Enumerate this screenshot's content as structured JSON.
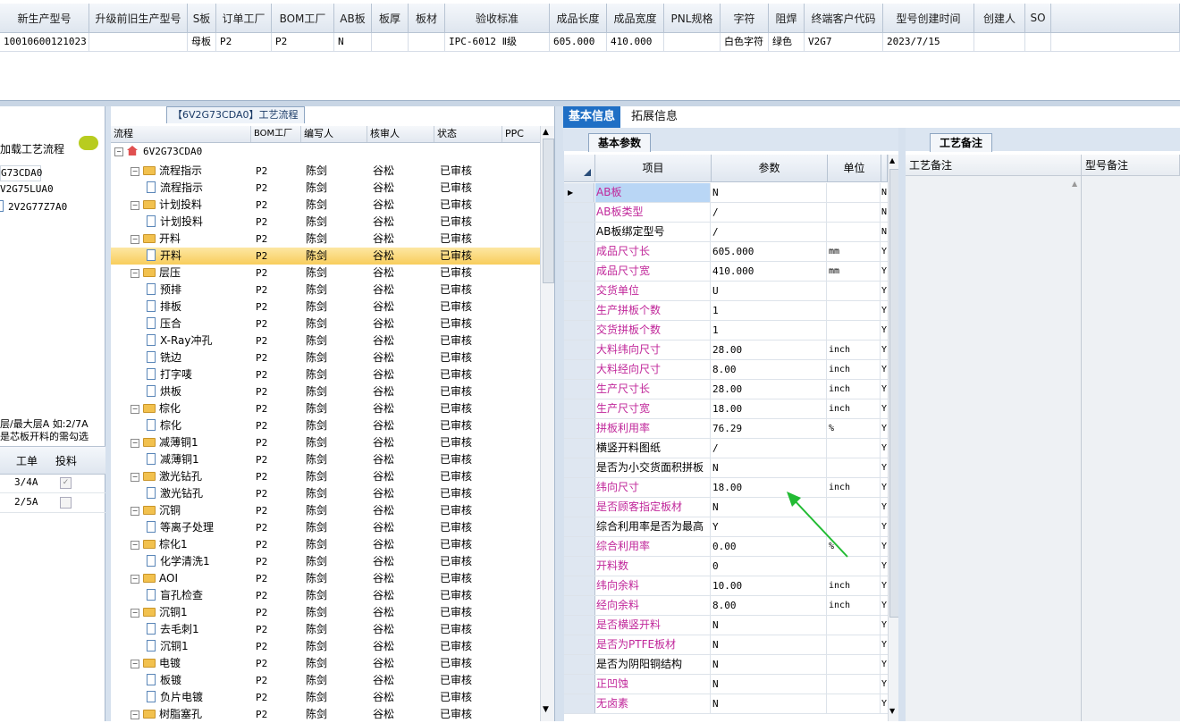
{
  "top_grid": {
    "headers": [
      "新生产型号",
      "升级前旧生产型号",
      "S板",
      "订单工厂",
      "BOM工厂",
      "AB板",
      "板厚",
      "板材",
      "验收标准",
      "成品长度",
      "成品宽度",
      "PNL规格",
      "字符",
      "阻焊",
      "终端客户代码",
      "型号创建时间",
      "创建人",
      "SO"
    ],
    "row": [
      "10010600121023",
      "",
      "母板",
      "P2",
      "P2",
      "N",
      "",
      "",
      "IPC-6012 Ⅱ级",
      "605.000",
      "410.000",
      "",
      "白色字符",
      "绿色",
      "V2G7",
      "2023/7/15",
      "",
      ""
    ]
  },
  "left": {
    "load_label": "加载工艺流程",
    "items": [
      "G73CDA0",
      "V2G75LUA0",
      "2V2G77Z7A0"
    ],
    "note1": "层/最大层A 如:2/7A",
    "note2": "是芯板开料的需勾选",
    "cols": [
      "工单",
      "投料"
    ],
    "rows": [
      {
        "a": "3/4A"
      },
      {
        "a": "2/5A"
      }
    ]
  },
  "mid": {
    "title": "【6V2G73CDA0】工艺流程",
    "cols": [
      "流程",
      "BOM工厂",
      "编写人",
      "核审人",
      "状态",
      "PPC"
    ],
    "root": "6V2G73CDA0",
    "rows": [
      {
        "t": "流程指示",
        "lvl": 1,
        "f": 1
      },
      {
        "t": "流程指示",
        "lvl": 2
      },
      {
        "t": "计划投料",
        "lvl": 1,
        "f": 1
      },
      {
        "t": "计划投料",
        "lvl": 2
      },
      {
        "t": "开料",
        "lvl": 1,
        "f": 1
      },
      {
        "t": "开料",
        "lvl": 2,
        "sel": 1
      },
      {
        "t": "层压",
        "lvl": 1,
        "f": 1
      },
      {
        "t": "预排",
        "lvl": 2
      },
      {
        "t": "排板",
        "lvl": 2
      },
      {
        "t": "压合",
        "lvl": 2
      },
      {
        "t": "X-Ray冲孔",
        "lvl": 2
      },
      {
        "t": "铣边",
        "lvl": 2
      },
      {
        "t": "打字唛",
        "lvl": 2
      },
      {
        "t": "烘板",
        "lvl": 2
      },
      {
        "t": "棕化",
        "lvl": 1,
        "f": 1
      },
      {
        "t": "棕化",
        "lvl": 2
      },
      {
        "t": "减薄铜1",
        "lvl": 1,
        "f": 1
      },
      {
        "t": "减薄铜1",
        "lvl": 2
      },
      {
        "t": "激光钻孔",
        "lvl": 1,
        "f": 1
      },
      {
        "t": "激光钻孔",
        "lvl": 2
      },
      {
        "t": "沉铜",
        "lvl": 1,
        "f": 1
      },
      {
        "t": "等离子处理",
        "lvl": 2
      },
      {
        "t": "棕化1",
        "lvl": 1,
        "f": 1
      },
      {
        "t": "化学清洗1",
        "lvl": 2
      },
      {
        "t": "AOI",
        "lvl": 1,
        "f": 1
      },
      {
        "t": "盲孔检查",
        "lvl": 2
      },
      {
        "t": "沉铜1",
        "lvl": 1,
        "f": 1
      },
      {
        "t": "去毛刺1",
        "lvl": 2
      },
      {
        "t": "沉铜1",
        "lvl": 2
      },
      {
        "t": "电镀",
        "lvl": 1,
        "f": 1
      },
      {
        "t": "板镀",
        "lvl": 2
      },
      {
        "t": "负片电镀",
        "lvl": 2
      },
      {
        "t": "树脂塞孔",
        "lvl": 1,
        "f": 1
      }
    ],
    "bom": "P2",
    "writer": "陈剑",
    "reviewer": "谷松",
    "status": "已审核"
  },
  "right": {
    "tabs": [
      "基本信息",
      "拓展信息"
    ],
    "subtab": "基本参数",
    "remark_tab": "工艺备注",
    "cols": [
      "项目",
      "参数",
      "单位"
    ],
    "remark_cols": [
      "工艺备注",
      "型号备注"
    ],
    "params": [
      {
        "k": "AB板",
        "v": "N",
        "u": "",
        "y": "N",
        "r": 1
      },
      {
        "k": "AB板类型",
        "v": "/",
        "u": "",
        "y": "N",
        "r": 1
      },
      {
        "k": "AB板绑定型号",
        "v": "/",
        "u": "",
        "y": "N",
        "r": 0
      },
      {
        "k": "成品尺寸长",
        "v": "605.000",
        "u": "mm",
        "y": "Y",
        "r": 1
      },
      {
        "k": "成品尺寸宽",
        "v": "410.000",
        "u": "mm",
        "y": "Y",
        "r": 1
      },
      {
        "k": "交货单位",
        "v": "U",
        "u": "",
        "y": "Y",
        "r": 1
      },
      {
        "k": "生产拼板个数",
        "v": "1",
        "u": "",
        "y": "Y",
        "r": 1
      },
      {
        "k": "交货拼板个数",
        "v": "1",
        "u": "",
        "y": "Y",
        "r": 1
      },
      {
        "k": "大料纬向尺寸",
        "v": "28.00",
        "u": "inch",
        "y": "Y",
        "r": 1
      },
      {
        "k": "大料经向尺寸",
        "v": "8.00",
        "u": "inch",
        "y": "Y",
        "r": 1
      },
      {
        "k": "生产尺寸长",
        "v": "28.00",
        "u": "inch",
        "y": "Y",
        "r": 1
      },
      {
        "k": "生产尺寸宽",
        "v": "18.00",
        "u": "inch",
        "y": "Y",
        "r": 1
      },
      {
        "k": "拼板利用率",
        "v": "76.29",
        "u": "%",
        "y": "Y",
        "r": 1
      },
      {
        "k": "横竖开料图纸",
        "v": "/",
        "u": "",
        "y": "Y",
        "r": 0
      },
      {
        "k": "是否为小交货面积拼板",
        "v": "N",
        "u": "",
        "y": "Y",
        "r": 0
      },
      {
        "k": "纬向尺寸",
        "v": "18.00",
        "u": "inch",
        "y": "Y",
        "r": 1
      },
      {
        "k": "是否顾客指定板材",
        "v": "N",
        "u": "",
        "y": "Y",
        "r": 1
      },
      {
        "k": "综合利用率是否为最高",
        "v": "Y",
        "u": "",
        "y": "Y",
        "r": 0
      },
      {
        "k": "综合利用率",
        "v": "0.00",
        "u": "%",
        "y": "Y",
        "r": 1
      },
      {
        "k": "开料数",
        "v": "0",
        "u": "",
        "y": "Y",
        "r": 1
      },
      {
        "k": "纬向余料",
        "v": "10.00",
        "u": "inch",
        "y": "Y",
        "r": 1
      },
      {
        "k": "经向余料",
        "v": "8.00",
        "u": "inch",
        "y": "Y",
        "r": 1
      },
      {
        "k": "是否横竖开料",
        "v": "N",
        "u": "",
        "y": "Y",
        "r": 1
      },
      {
        "k": "是否为PTFE板材",
        "v": "N",
        "u": "",
        "y": "Y",
        "r": 1
      },
      {
        "k": "是否为阴阳铜结构",
        "v": "N",
        "u": "",
        "y": "Y",
        "r": 0
      },
      {
        "k": "正凹蚀",
        "v": "N",
        "u": "",
        "y": "Y",
        "r": 1
      },
      {
        "k": "无卤素",
        "v": "N",
        "u": "",
        "y": "Y",
        "r": 1
      }
    ]
  },
  "colors": {
    "accent": "#1f6fc5",
    "label_red": "#c0279a",
    "select": "#f8cd5c",
    "arrow": "#22bb33"
  }
}
